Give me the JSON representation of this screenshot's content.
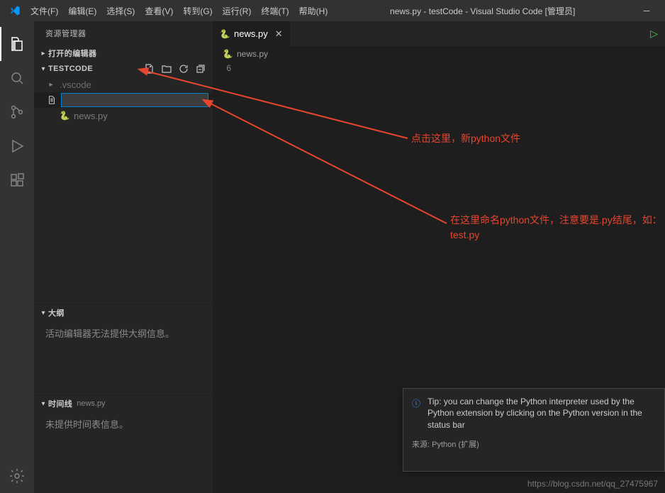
{
  "colors": {
    "accent": "#007fd4",
    "annotation": "#e6452f"
  },
  "titlebar": {
    "menus": [
      "文件(F)",
      "编辑(E)",
      "选择(S)",
      "查看(V)",
      "转到(G)",
      "运行(R)",
      "终端(T)",
      "帮助(H)"
    ],
    "title": "news.py - testCode - Visual Studio Code [管理员]"
  },
  "sidebar": {
    "title": "资源管理器",
    "open_editors_label": "打开的编辑器",
    "folder_label": "TESTCODE",
    "tree": {
      "vscode_dir": ".vscode",
      "new_file_value": "",
      "news_file": "news.py"
    },
    "outline": {
      "label": "大纲",
      "body": "活动编辑器无法提供大纲信息。"
    },
    "timeline": {
      "label": "时间线",
      "sub": "news.py",
      "body": "未提供时间表信息。"
    }
  },
  "tabs": {
    "active": "news.py"
  },
  "breadcrumb": {
    "file": "news.py"
  },
  "gutter": {
    "line": "6"
  },
  "annotations": {
    "a1": "点击这里，新python文件",
    "a2": "在这里命名python文件，注意要是.py结尾，如：test.py"
  },
  "notification": {
    "text": "Tip: you can change the Python interpreter used by the Python extension by clicking on the Python version in the status bar",
    "source_prefix": "来源: ",
    "source": "Python (扩展)"
  },
  "watermark": "https://blog.csdn.net/qq_27475967"
}
